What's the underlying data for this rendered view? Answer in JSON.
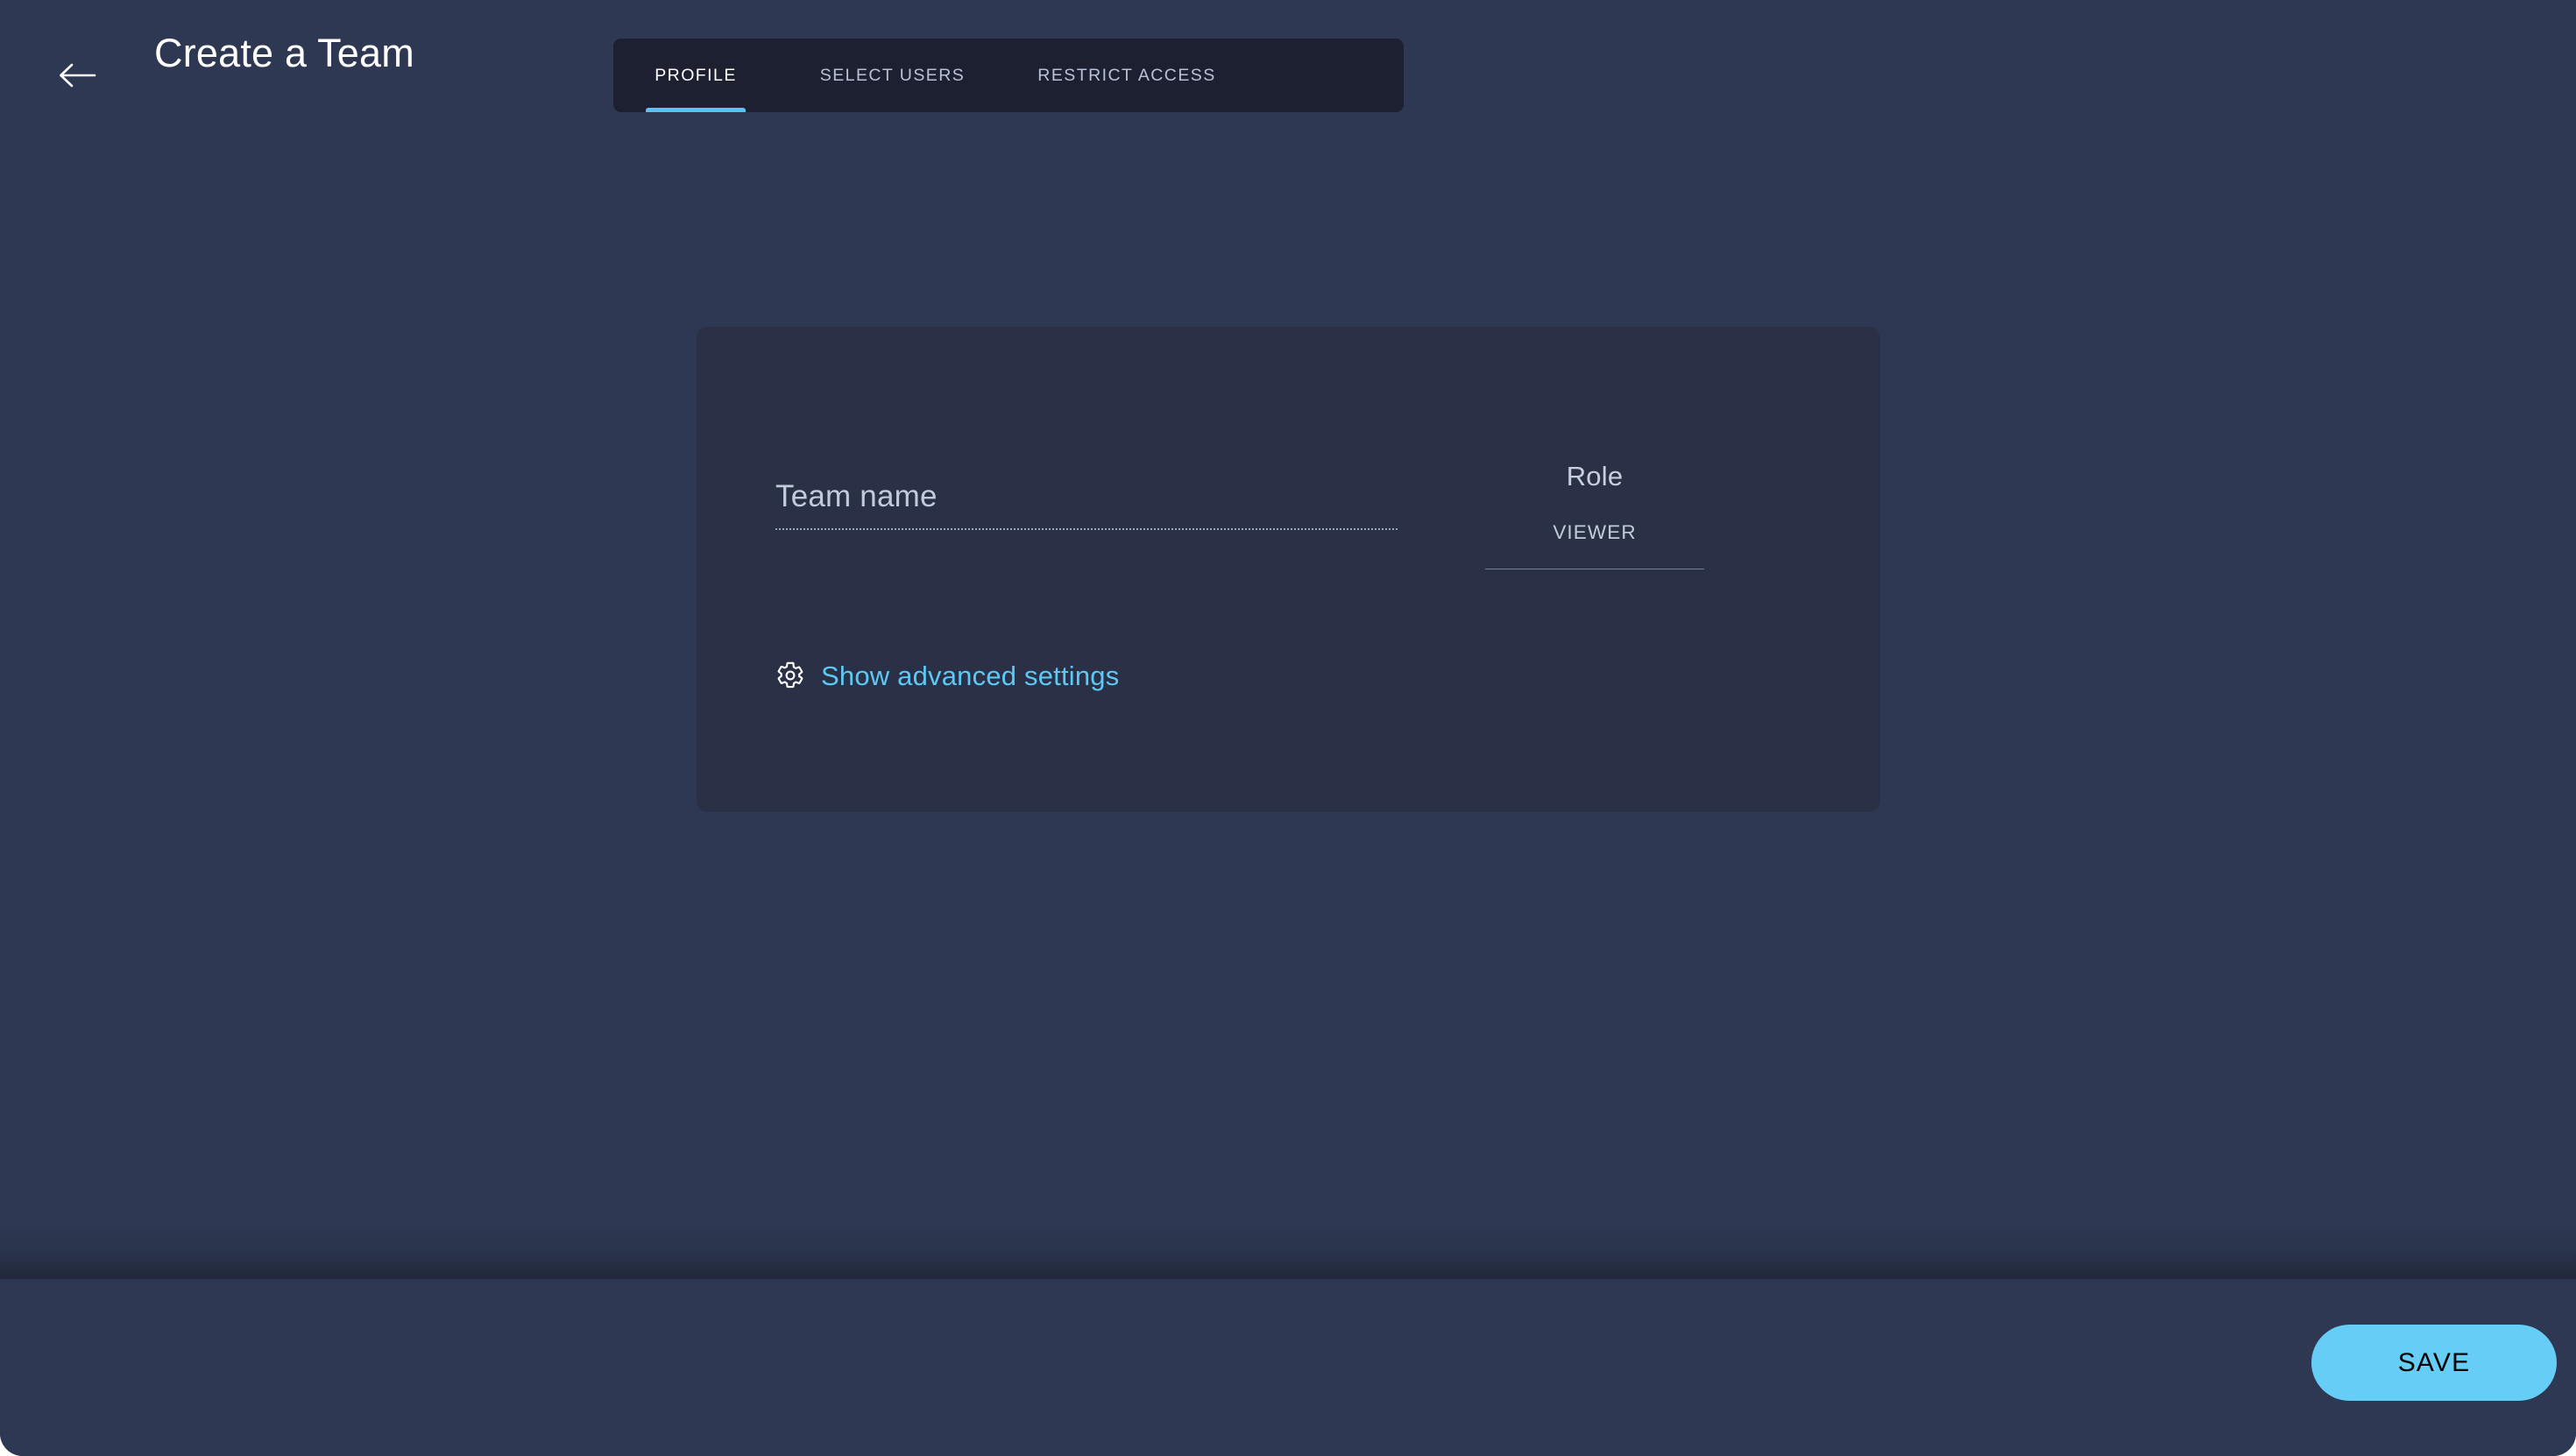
{
  "header": {
    "back_icon": "arrow-left-icon",
    "title": "Create a Team"
  },
  "tabs": [
    {
      "label": "PROFILE",
      "active": true
    },
    {
      "label": "SELECT USERS",
      "active": false
    },
    {
      "label": "RESTRICT ACCESS",
      "active": false
    }
  ],
  "form": {
    "team_name": {
      "label": "Team name",
      "placeholder": "Team name",
      "value": ""
    },
    "role": {
      "label": "Role",
      "value": "VIEWER"
    },
    "advanced": {
      "icon": "gear-icon",
      "label": "Show advanced settings"
    }
  },
  "footer": {
    "save_label": "SAVE"
  },
  "colors": {
    "page_background": "#2e3852",
    "card_background": "#2a3146",
    "tabbar_background": "#1c2030",
    "accent": "#56c4f2",
    "link": "#5ec8f5",
    "save_button": "#66cdf7",
    "save_button_text": "#000000",
    "text_primary": "#ffffff",
    "text_muted": "#b9c1d8"
  }
}
